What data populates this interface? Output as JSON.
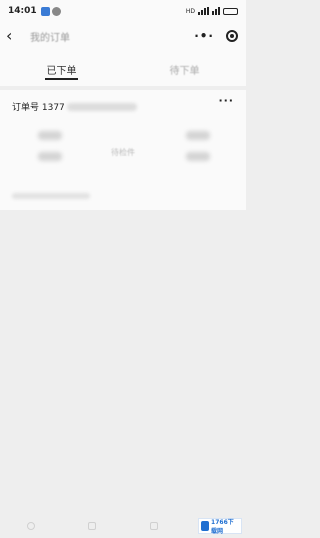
{
  "status_bar": {
    "time": "14:01",
    "network": "HD"
  },
  "nav": {
    "title": "我的订单"
  },
  "tabs": [
    {
      "label": "已下单",
      "active": true
    },
    {
      "label": "待下单",
      "active": false
    }
  ],
  "order": {
    "label": "订单号 1377",
    "center_text": "待检件"
  },
  "watermark": {
    "text": "1766下载网"
  },
  "colors": {
    "background": "#eeeeee",
    "card": "#fafafa",
    "text": "#222222",
    "muted": "#aaaaaa"
  }
}
